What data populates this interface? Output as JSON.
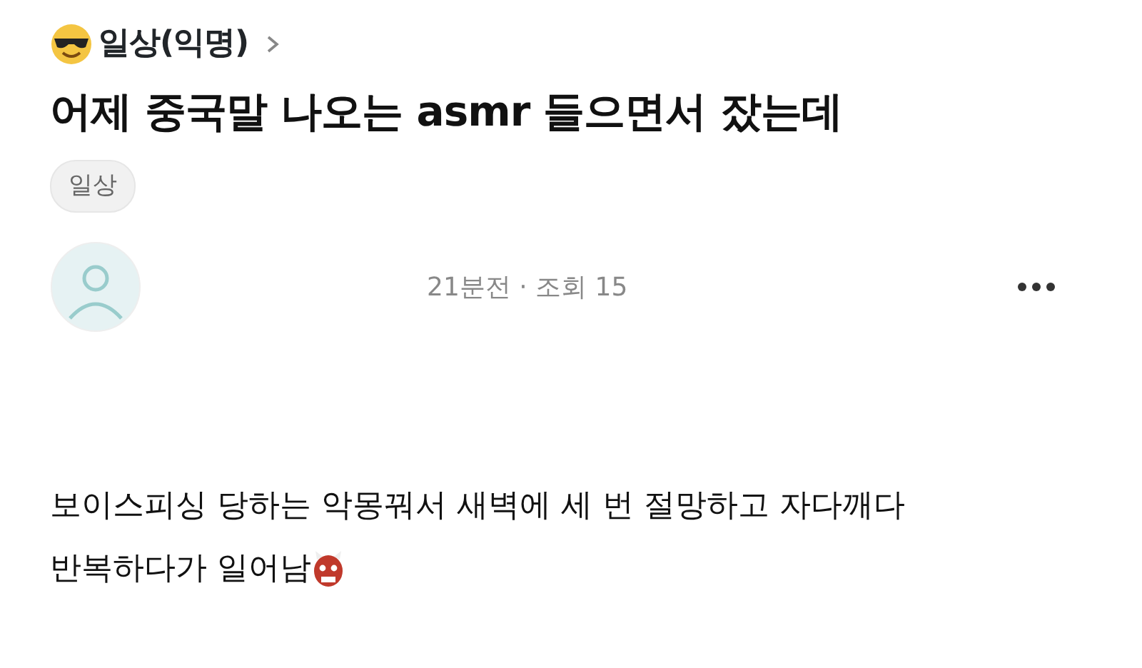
{
  "board": {
    "name": "일상(익명)"
  },
  "title": "어제 중국말 나오는 asmr 들으면서 잤는데",
  "tags": [
    "일상"
  ],
  "meta": "21분전 · 조회 15",
  "body_lines": [
    "보이스피싱 당하는 악몽꿔서 새벽에 세 번 절망하고 자다깨다",
    "반복하다가 일어남"
  ]
}
